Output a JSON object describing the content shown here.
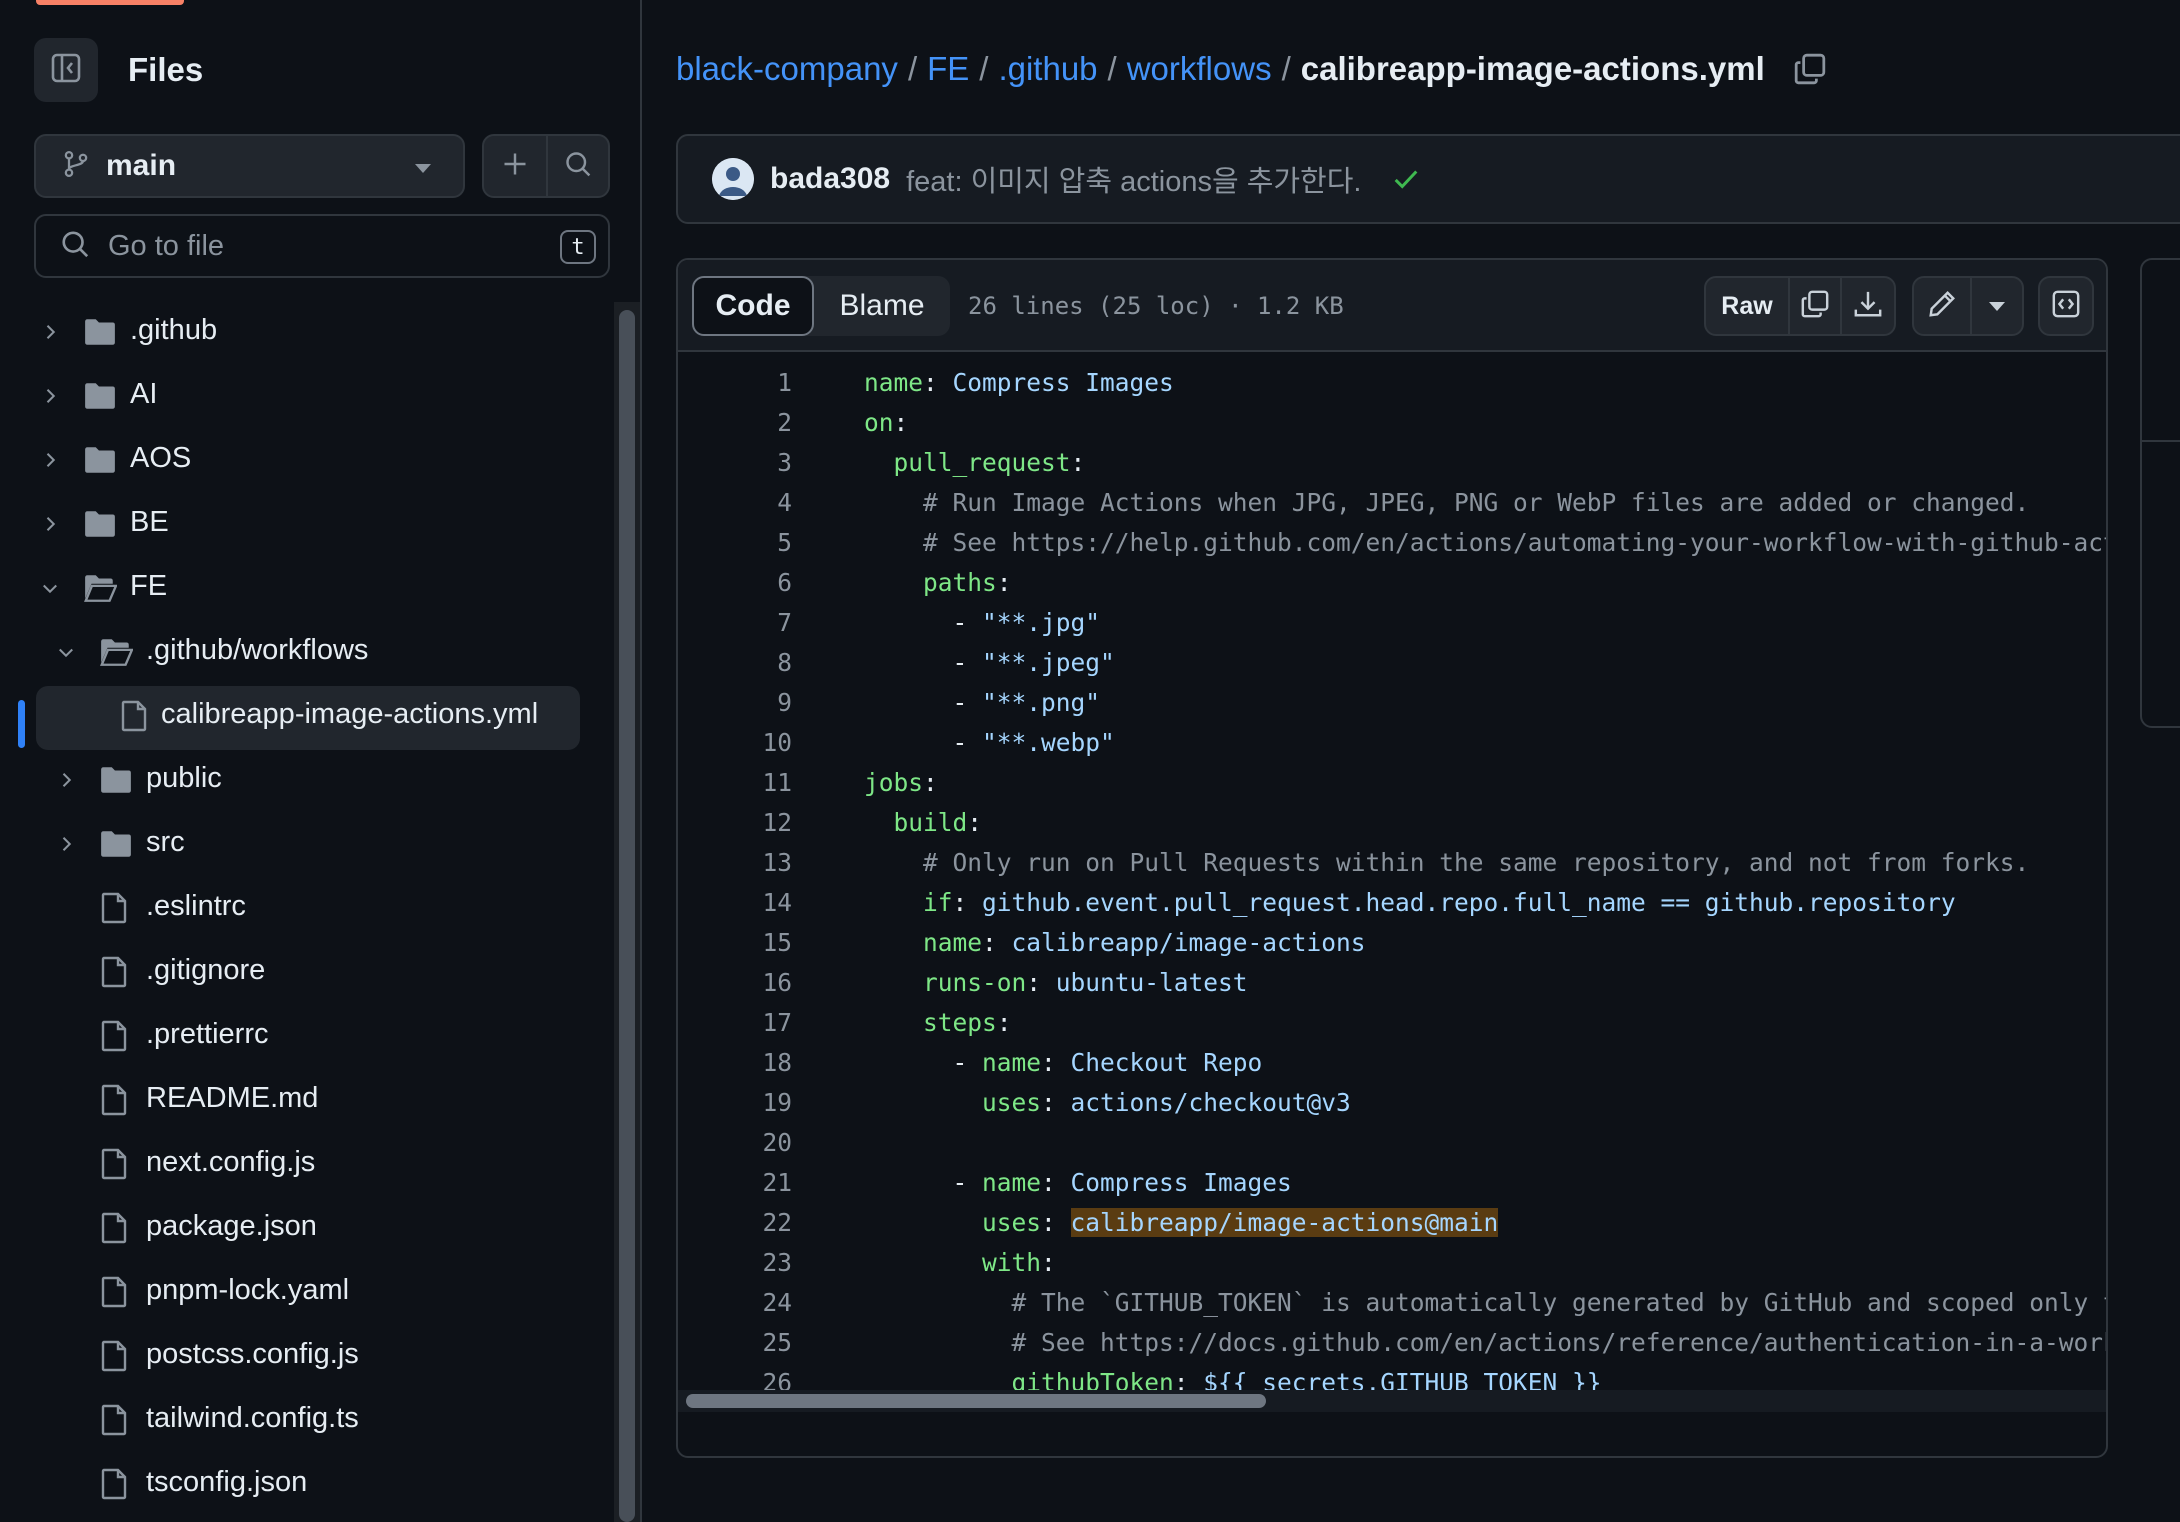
{
  "sidebar": {
    "title": "Files",
    "branch": "main",
    "search_placeholder": "Go to file",
    "search_shortcut": "t",
    "tree": [
      {
        "name": ".github",
        "type": "folder",
        "expanded": false
      },
      {
        "name": "AI",
        "type": "folder",
        "expanded": false
      },
      {
        "name": "AOS",
        "type": "folder",
        "expanded": false
      },
      {
        "name": "BE",
        "type": "folder",
        "expanded": false
      },
      {
        "name": "FE",
        "type": "folder",
        "expanded": true
      },
      {
        "name": ".github/workflows",
        "type": "folder",
        "expanded": true
      },
      {
        "name": "calibreapp-image-actions.yml",
        "type": "file",
        "selected": true
      },
      {
        "name": "public",
        "type": "folder",
        "expanded": false
      },
      {
        "name": "src",
        "type": "folder",
        "expanded": false
      },
      {
        "name": ".eslintrc",
        "type": "file"
      },
      {
        "name": ".gitignore",
        "type": "file"
      },
      {
        "name": ".prettierrc",
        "type": "file"
      },
      {
        "name": "README.md",
        "type": "file"
      },
      {
        "name": "next.config.js",
        "type": "file"
      },
      {
        "name": "package.json",
        "type": "file"
      },
      {
        "name": "pnpm-lock.yaml",
        "type": "file"
      },
      {
        "name": "postcss.config.js",
        "type": "file"
      },
      {
        "name": "tailwind.config.ts",
        "type": "file"
      },
      {
        "name": "tsconfig.json",
        "type": "file"
      }
    ]
  },
  "breadcrumb": {
    "parts": [
      "black-company",
      "FE",
      ".github",
      "workflows"
    ],
    "separator": "/",
    "current": "calibreapp-image-actions.yml"
  },
  "commit": {
    "author": "bada308",
    "message": "feat: 이미지 압축 actions을 추가한다."
  },
  "file": {
    "tabs": {
      "code": "Code",
      "blame": "Blame"
    },
    "meta": "26 lines (25 loc) · 1.2 KB",
    "raw_label": "Raw"
  },
  "code_lines": [
    [
      {
        "t": "name",
        "c": "k"
      },
      {
        "t": ": ",
        "c": "p"
      },
      {
        "t": "Compress Images",
        "c": "s"
      }
    ],
    [
      {
        "t": "on",
        "c": "k"
      },
      {
        "t": ":",
        "c": "p"
      }
    ],
    [
      {
        "t": "  "
      },
      {
        "t": "pull_request",
        "c": "k"
      },
      {
        "t": ":",
        "c": "p"
      }
    ],
    [
      {
        "t": "    "
      },
      {
        "t": "# Run Image Actions when JPG, JPEG, PNG or WebP files are added or changed.",
        "c": "c"
      }
    ],
    [
      {
        "t": "    "
      },
      {
        "t": "# See https://help.github.com/en/actions/automating-your-workflow-with-github-acti",
        "c": "c"
      }
    ],
    [
      {
        "t": "    "
      },
      {
        "t": "paths",
        "c": "k"
      },
      {
        "t": ":",
        "c": "p"
      }
    ],
    [
      {
        "t": "      - ",
        "c": "p"
      },
      {
        "t": "\"**.jpg\"",
        "c": "s"
      }
    ],
    [
      {
        "t": "      - ",
        "c": "p"
      },
      {
        "t": "\"**.jpeg\"",
        "c": "s"
      }
    ],
    [
      {
        "t": "      - ",
        "c": "p"
      },
      {
        "t": "\"**.png\"",
        "c": "s"
      }
    ],
    [
      {
        "t": "      - ",
        "c": "p"
      },
      {
        "t": "\"**.webp\"",
        "c": "s"
      }
    ],
    [
      {
        "t": "jobs",
        "c": "k"
      },
      {
        "t": ":",
        "c": "p"
      }
    ],
    [
      {
        "t": "  "
      },
      {
        "t": "build",
        "c": "k"
      },
      {
        "t": ":",
        "c": "p"
      }
    ],
    [
      {
        "t": "    "
      },
      {
        "t": "# Only run on Pull Requests within the same repository, and not from forks.",
        "c": "c"
      }
    ],
    [
      {
        "t": "    "
      },
      {
        "t": "if",
        "c": "k"
      },
      {
        "t": ": ",
        "c": "p"
      },
      {
        "t": "github.event.pull_request.head.repo.full_name == github.repository",
        "c": "s"
      }
    ],
    [
      {
        "t": "    "
      },
      {
        "t": "name",
        "c": "k"
      },
      {
        "t": ": ",
        "c": "p"
      },
      {
        "t": "calibreapp/image-actions",
        "c": "s"
      }
    ],
    [
      {
        "t": "    "
      },
      {
        "t": "runs-on",
        "c": "k"
      },
      {
        "t": ": ",
        "c": "p"
      },
      {
        "t": "ubuntu-latest",
        "c": "s"
      }
    ],
    [
      {
        "t": "    "
      },
      {
        "t": "steps",
        "c": "k"
      },
      {
        "t": ":",
        "c": "p"
      }
    ],
    [
      {
        "t": "      - ",
        "c": "p"
      },
      {
        "t": "name",
        "c": "k"
      },
      {
        "t": ": ",
        "c": "p"
      },
      {
        "t": "Checkout Repo",
        "c": "s"
      }
    ],
    [
      {
        "t": "        "
      },
      {
        "t": "uses",
        "c": "k"
      },
      {
        "t": ": ",
        "c": "p"
      },
      {
        "t": "actions/checkout@v3",
        "c": "s"
      }
    ],
    [],
    [
      {
        "t": "      - ",
        "c": "p"
      },
      {
        "t": "name",
        "c": "k"
      },
      {
        "t": ": ",
        "c": "p"
      },
      {
        "t": "Compress Images",
        "c": "s"
      }
    ],
    [
      {
        "t": "        "
      },
      {
        "t": "uses",
        "c": "k"
      },
      {
        "t": ": ",
        "c": "p"
      },
      {
        "t": "calibreapp/image-actions@main",
        "c": "s",
        "hl": true
      }
    ],
    [
      {
        "t": "        "
      },
      {
        "t": "with",
        "c": "k"
      },
      {
        "t": ":",
        "c": "p"
      }
    ],
    [
      {
        "t": "          "
      },
      {
        "t": "# The `GITHUB_TOKEN` is automatically generated by GitHub and scoped only to",
        "c": "c"
      }
    ],
    [
      {
        "t": "          "
      },
      {
        "t": "# See https://docs.github.com/en/actions/reference/authentication-in-a-workf",
        "c": "c"
      }
    ],
    [
      {
        "t": "          "
      },
      {
        "t": "githubToken",
        "c": "k"
      },
      {
        "t": ": ",
        "c": "p"
      },
      {
        "t": "${{ secrets.GITHUB_TOKEN }}",
        "c": "s"
      }
    ]
  ],
  "colors": {
    "background": "#0d1117",
    "link": "#4493f8",
    "yaml_key": "#7ee787",
    "yaml_value": "#a5d6ff",
    "comment": "#8b949e",
    "selection_bar": "#2f81f7",
    "success": "#3fb950"
  },
  "icons": {
    "sidebar_toggle": "sidebar-collapse-icon",
    "branch": "git-branch-icon",
    "add": "plus-icon",
    "search": "search-icon",
    "copy": "copy-icon",
    "download": "download-icon",
    "edit": "pencil-icon",
    "symbols": "code-square-icon"
  }
}
